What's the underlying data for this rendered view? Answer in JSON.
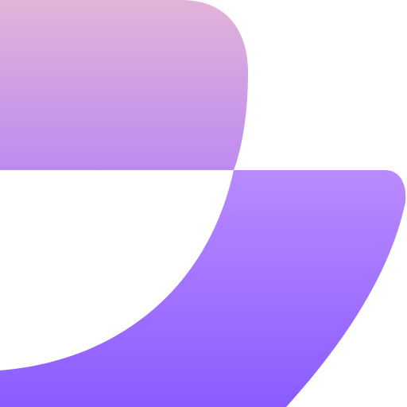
{
  "artwork": {
    "name": "abstract-logo-mark",
    "colors": {
      "background": "#ffffff",
      "top_shape_start": "#E2B4D8",
      "top_shape_end": "#BE8AF0",
      "bottom_shape_start": "#B98BFF",
      "bottom_shape_end": "#8A5CFF"
    }
  }
}
